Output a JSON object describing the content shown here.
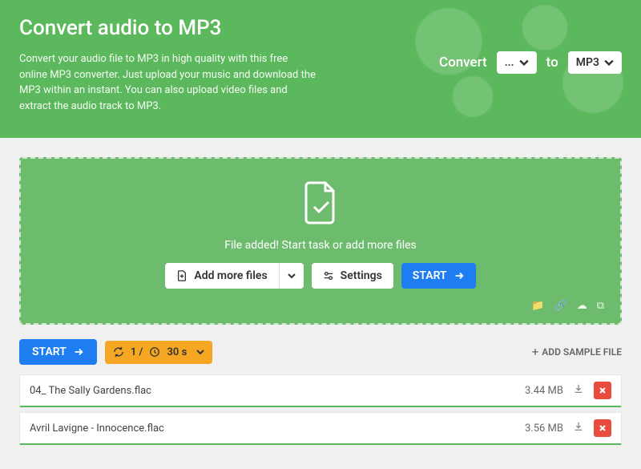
{
  "hero": {
    "title": "Convert audio to MP3",
    "description": "Convert your audio file to MP3 in high quality with this free online MP3 converter. Just upload your music and download the MP3 within an instant. You can also upload video files and extract the audio track to MP3.",
    "convert_label": "Convert",
    "to_label": "to",
    "from_value": "...",
    "to_value": "MP3"
  },
  "dropzone": {
    "message": "File added! Start task or add more files",
    "add_more": "Add more files",
    "settings": "Settings",
    "start": "START"
  },
  "row2": {
    "start": "START",
    "batch": "1 / ",
    "batch_time": "30 s",
    "sample": "ADD SAMPLE FILE"
  },
  "files": [
    {
      "name": "04_ The Sally Gardens.flac",
      "size": "3.44 MB"
    },
    {
      "name": "Avril Lavigne - Innocence.flac",
      "size": "3.56 MB"
    }
  ]
}
